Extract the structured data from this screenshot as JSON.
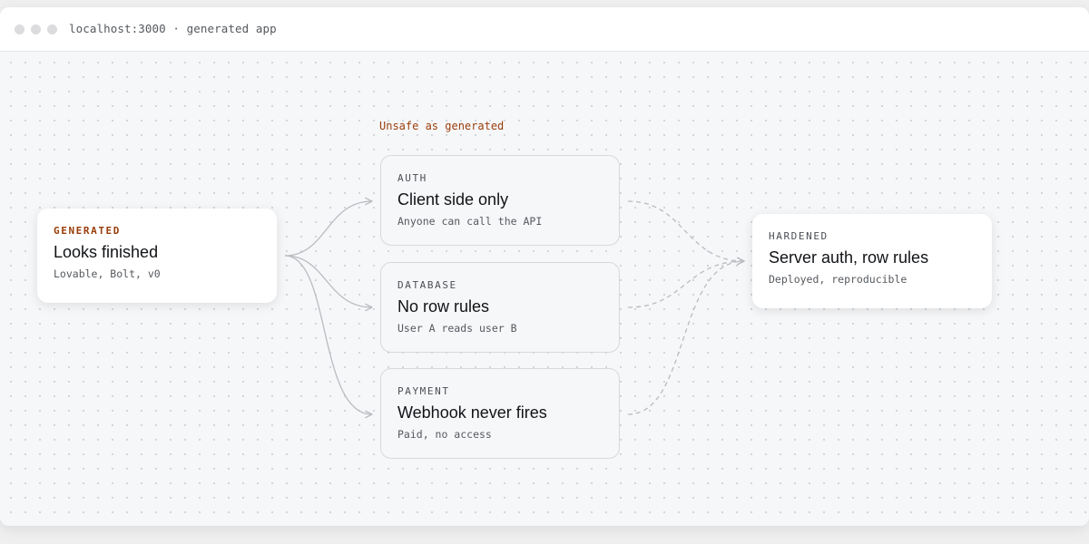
{
  "window": {
    "address": "localhost:3000 · generated app",
    "controls": [
      "close",
      "minimize",
      "zoom"
    ]
  },
  "diagram": {
    "group_label": "Unsafe as generated",
    "source": {
      "kicker": "GENERATED",
      "title": "Looks finished",
      "subtitle": "Lovable, Bolt, v0"
    },
    "issues": [
      {
        "kicker": "AUTH",
        "title": "Client side only",
        "subtitle": "Anyone can call the API"
      },
      {
        "kicker": "DATABASE",
        "title": "No row rules",
        "subtitle": "User A reads user B"
      },
      {
        "kicker": "PAYMENT",
        "title": "Webhook never fires",
        "subtitle": "Paid, no access"
      }
    ],
    "target": {
      "kicker": "HARDENED",
      "title": "Server auth, row rules",
      "subtitle": "Deployed, reproducible"
    },
    "edges": [
      {
        "from": "source",
        "to": "auth",
        "style": "solid"
      },
      {
        "from": "source",
        "to": "database",
        "style": "solid"
      },
      {
        "from": "source",
        "to": "payment",
        "style": "solid"
      },
      {
        "from": "auth",
        "to": "target",
        "style": "dashed"
      },
      {
        "from": "database",
        "to": "target",
        "style": "dashed"
      },
      {
        "from": "payment",
        "to": "target",
        "style": "dashed"
      }
    ]
  },
  "colors": {
    "accent": "#9a3d0a",
    "edge": "#b9bcc0",
    "card_border": "#d6d8dc"
  }
}
